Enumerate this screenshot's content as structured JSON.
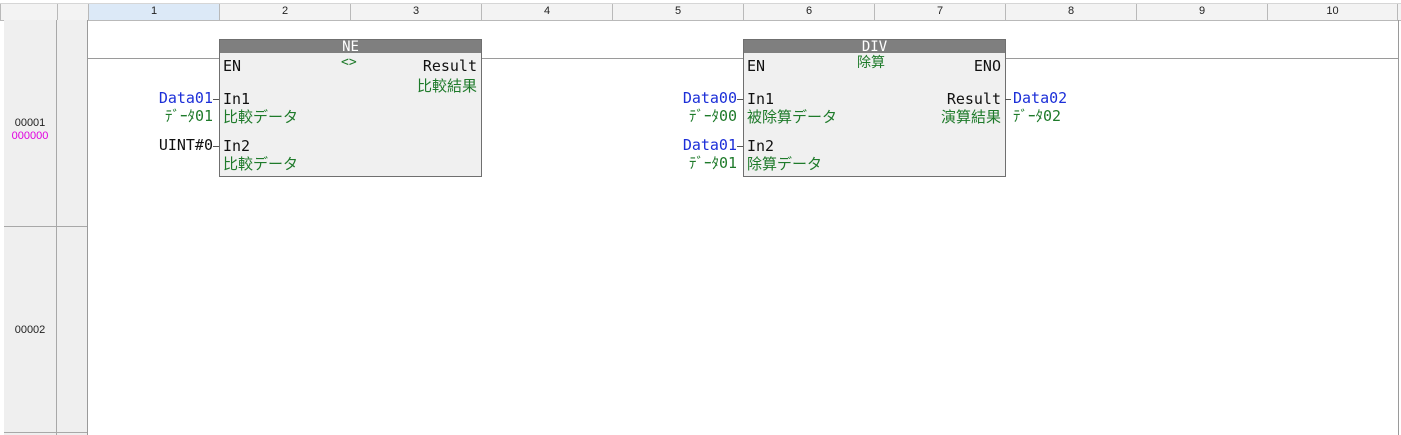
{
  "columns": [
    "1",
    "2",
    "3",
    "4",
    "5",
    "6",
    "7",
    "8",
    "9",
    "10"
  ],
  "rows": [
    {
      "number": "00001",
      "address": "000000"
    },
    {
      "number": "00002"
    }
  ],
  "blocks": [
    {
      "name": "NE",
      "comment": "<>",
      "pins": {
        "en": "EN",
        "in1": "In1",
        "in1_comment": "比較データ",
        "in2": "In2",
        "in2_comment": "比較データ",
        "out": "Result",
        "out_comment": "比較結果"
      },
      "inputs": [
        {
          "variable": "Data01",
          "comment": "ﾃﾞｰﾀ01"
        },
        {
          "variable": "UINT#0"
        }
      ]
    },
    {
      "name": "DIV",
      "comment": "除算",
      "pins": {
        "en": "EN",
        "eno": "ENO",
        "in1": "In1",
        "in1_comment": "被除算データ",
        "in2": "In2",
        "in2_comment": "除算データ",
        "out": "Result",
        "out_comment": "演算結果"
      },
      "inputs": [
        {
          "variable": "Data00",
          "comment": "ﾃﾞｰﾀ00"
        },
        {
          "variable": "Data01",
          "comment": "ﾃﾞｰﾀ01"
        }
      ],
      "output": {
        "variable": "Data02",
        "comment": "ﾃﾞｰﾀ02"
      }
    }
  ],
  "colors": {
    "variable": "#1c2fd8",
    "comment": "#1e7a2a",
    "address": "#e000e0",
    "header": "#7f7f7f"
  }
}
